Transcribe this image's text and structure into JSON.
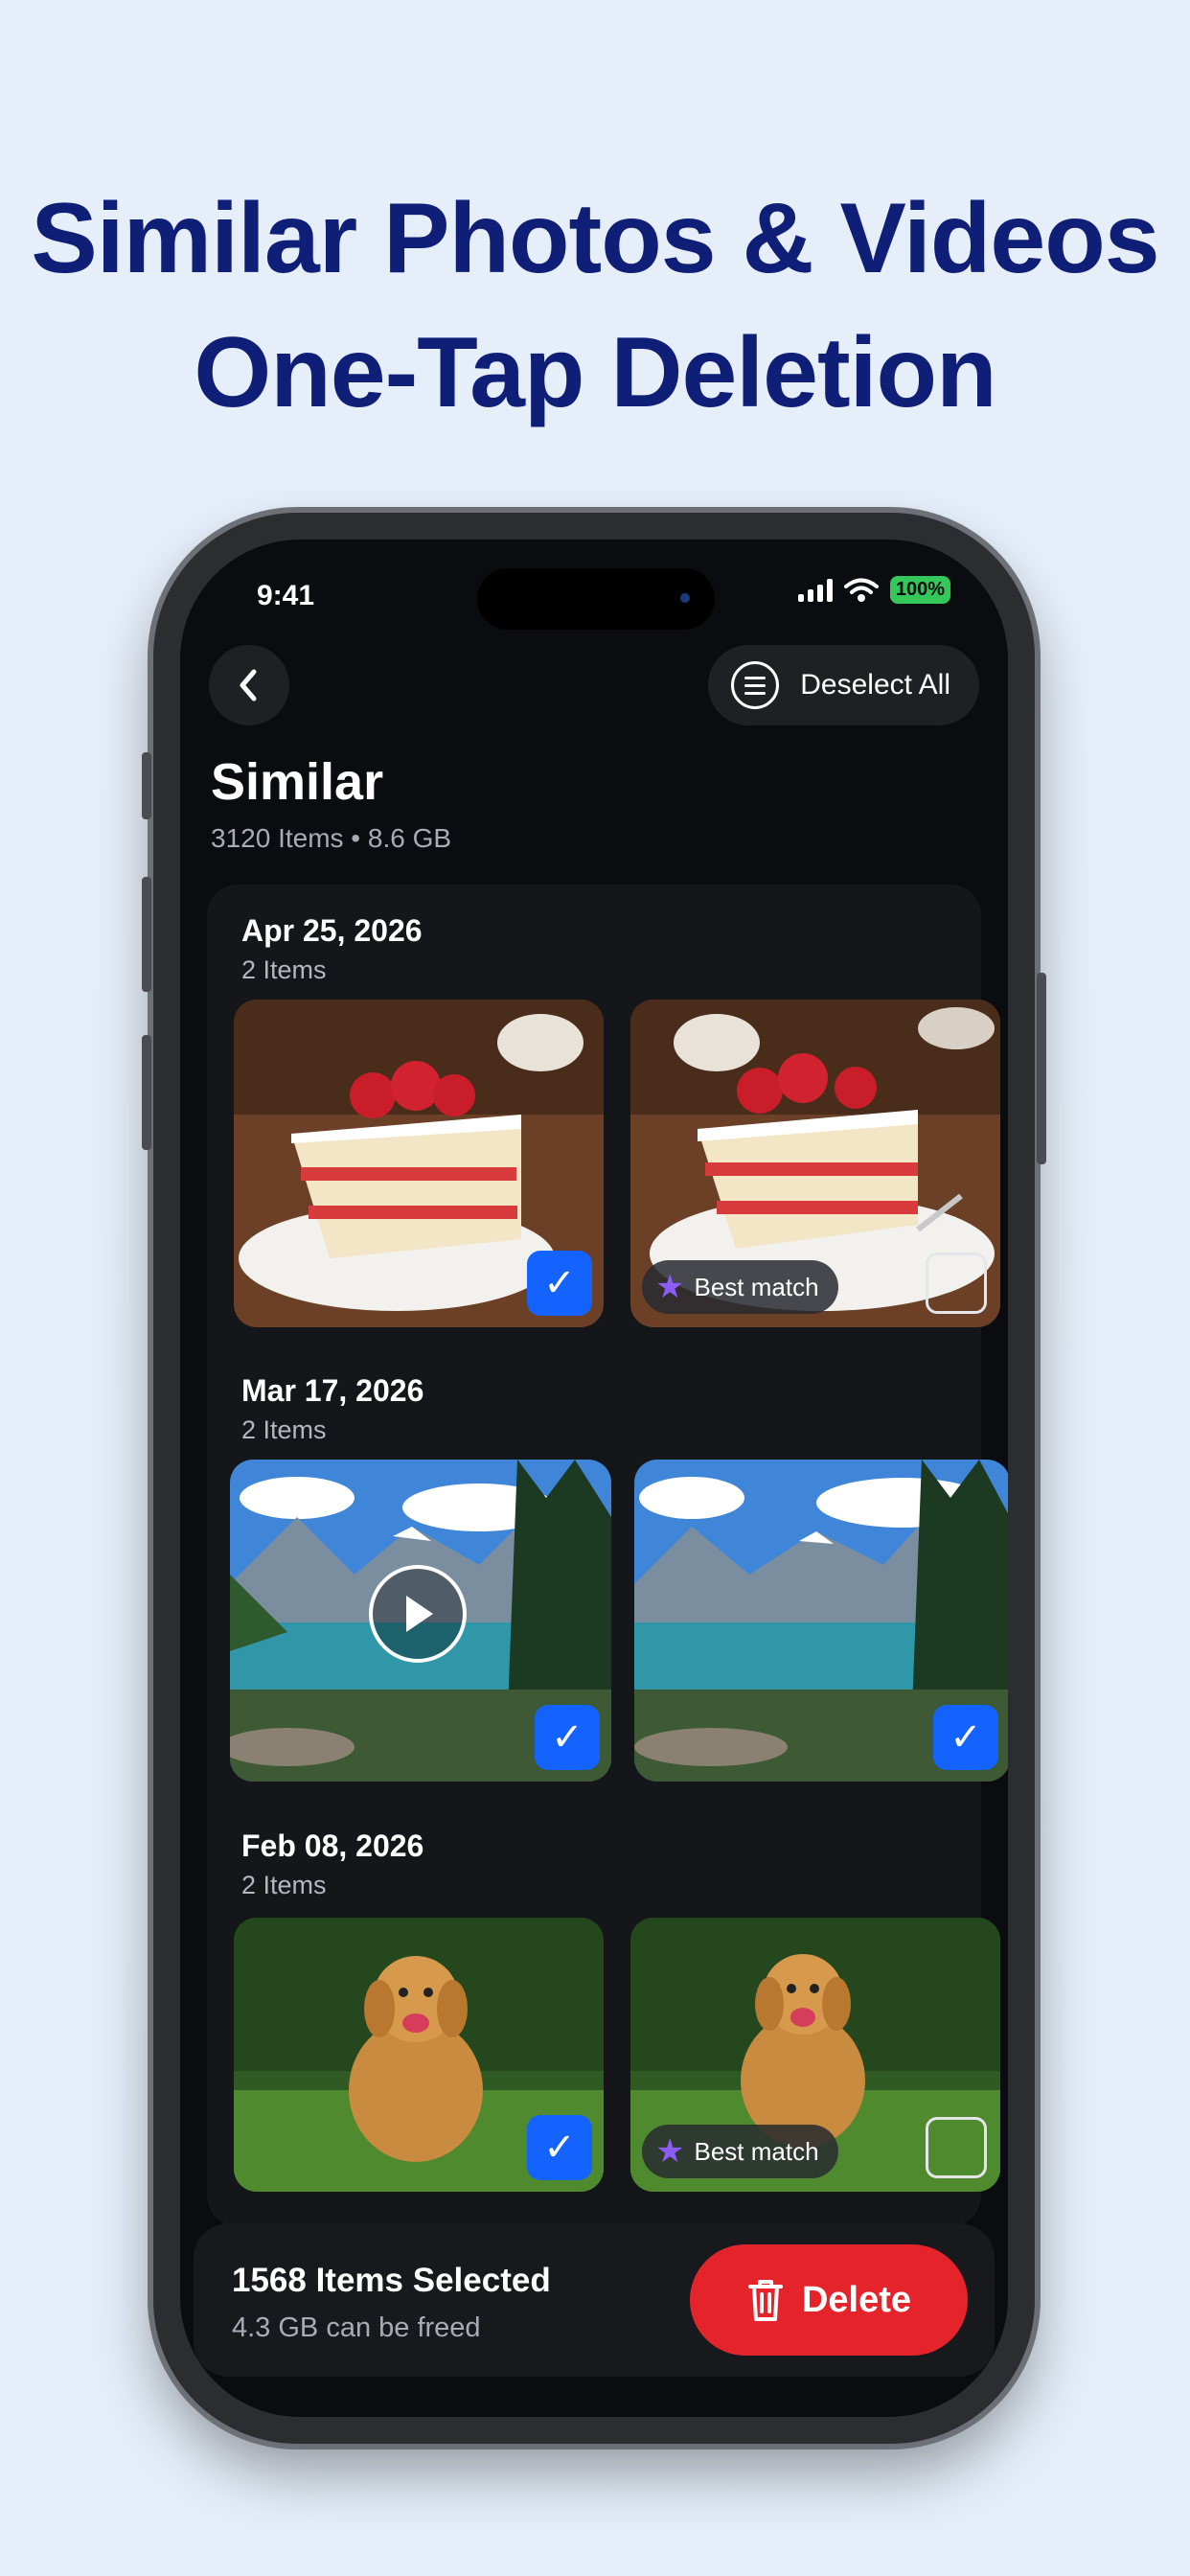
{
  "headline": {
    "line1": "Similar Photos & Videos",
    "line2": "One-Tap Deletion"
  },
  "status_bar": {
    "time": "9:41",
    "battery": "100%"
  },
  "nav": {
    "back_icon": "chevron-left-icon",
    "deselect_label": "Deselect All",
    "deselect_icon": "list-icon"
  },
  "page": {
    "title": "Similar",
    "subtitle": "3120 Items • 8.6 GB"
  },
  "groups": [
    {
      "date": "Apr 25, 2026",
      "count": "2 Items",
      "items": [
        {
          "subject": "strawberry-cake",
          "selected": true,
          "best_match": false,
          "video": false
        },
        {
          "subject": "strawberry-cake",
          "selected": false,
          "best_match": true,
          "video": false
        }
      ]
    },
    {
      "date": "Mar 17, 2026",
      "count": "2 Items",
      "items": [
        {
          "subject": "mountain-lake",
          "selected": true,
          "best_match": false,
          "video": true
        },
        {
          "subject": "mountain-lake",
          "selected": true,
          "best_match": false,
          "video": false
        }
      ]
    },
    {
      "date": "Feb 08, 2026",
      "count": "2 Items",
      "items": [
        {
          "subject": "golden-retriever",
          "selected": true,
          "best_match": false,
          "video": false
        },
        {
          "subject": "golden-retriever",
          "selected": false,
          "best_match": true,
          "video": false
        }
      ]
    }
  ],
  "best_match_label": "Best match",
  "footer": {
    "selected_label": "1568 Items Selected",
    "freed_label": "4.3 GB can be freed",
    "delete_label": "Delete"
  },
  "colors": {
    "headline": "#0f1f78",
    "accent_blue": "#1463ff",
    "delete_red": "#e5232b",
    "best_star": "#8b5cf6",
    "battery": "#34c759"
  }
}
